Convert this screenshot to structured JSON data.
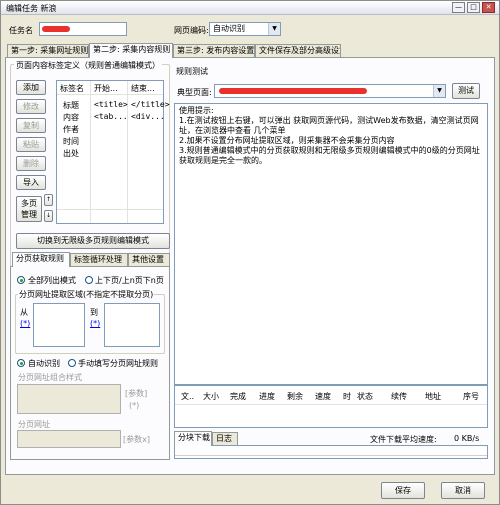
{
  "window": {
    "title": "编辑任务 新浪"
  },
  "top": {
    "task_name_label": "任务名",
    "task_name_value": "",
    "encoding_label": "网页编码:",
    "encoding_value": "自动识别"
  },
  "tabs": [
    {
      "label": "第一步: 采集网址规则"
    },
    {
      "label": "第二步: 采集内容规则"
    },
    {
      "label": "第三步: 发布内容设置"
    },
    {
      "label": "文件保存及部分高级设置"
    }
  ],
  "tag_def": {
    "title": "页面内容标签定义（规则普通编辑模式）",
    "buttons": [
      "添加",
      "修改",
      "复制",
      "粘贴",
      "删除",
      "导入"
    ],
    "columns": [
      "标签名",
      "开始...",
      "结束..."
    ],
    "rows": [
      [
        "标题",
        "<title>",
        "</title>"
      ],
      [
        "内容",
        "<tab...",
        "<div..."
      ],
      [
        "作者",
        "",
        ""
      ],
      [
        "时间",
        "",
        ""
      ],
      [
        "出处",
        "",
        ""
      ]
    ],
    "multi_page_btn": "多页\n管理",
    "switch_btn": "切换到无限级多页规则编辑模式"
  },
  "sub_tabs": [
    "分页获取规则",
    "标签循环处理",
    "其他设置"
  ],
  "paging": {
    "radio_all": "全部列出模式",
    "radio_updown": "上下页/上n页下n页",
    "extract_area_label": "分页网址提取区域(不指定不提取分页)",
    "from_label": "从",
    "to_label": "到",
    "from_link": "(*)",
    "to_link": "(*)",
    "radio_auto": "自动识别",
    "radio_manual": "手动填写分页网址规则",
    "combine_label": "分页网址组合样式",
    "param_label": "[参数]",
    "param_star": "(*)",
    "page_url_label": "分页网址",
    "param_x_label": "[参数x]"
  },
  "rule_test": {
    "title": "规则测试",
    "typical_label": "典型页面:",
    "test_btn": "测试",
    "tips": [
      "使用提示:",
      "1.在测试按钮上右键，可以弹出 获取网页源代码，测试Web发布数据，清空测试页网址，在浏览器中查看 几个菜单",
      "2.加果不设置分布网址提取区域，则采集器不会采集分页内容",
      "3.规则普通编辑模式中的分页获取规则和无限级多页规则编辑模式中的0级的分页网址获取规则是完全一款的。"
    ]
  },
  "download": {
    "columns": [
      "文..",
      "大小",
      "完成",
      "进度",
      "剩余",
      "速度",
      "时",
      "状态",
      "续传",
      "地址",
      "序号"
    ],
    "tabs": [
      "分块下载",
      "日志"
    ],
    "avg_speed_label": "文件下载平均速度:",
    "avg_speed_value": "0 KB/s"
  },
  "footer": {
    "save": "保存",
    "cancel": "取消"
  },
  "colors": {
    "accent_red": "#e8322b",
    "tab_border": "#919b9c"
  }
}
